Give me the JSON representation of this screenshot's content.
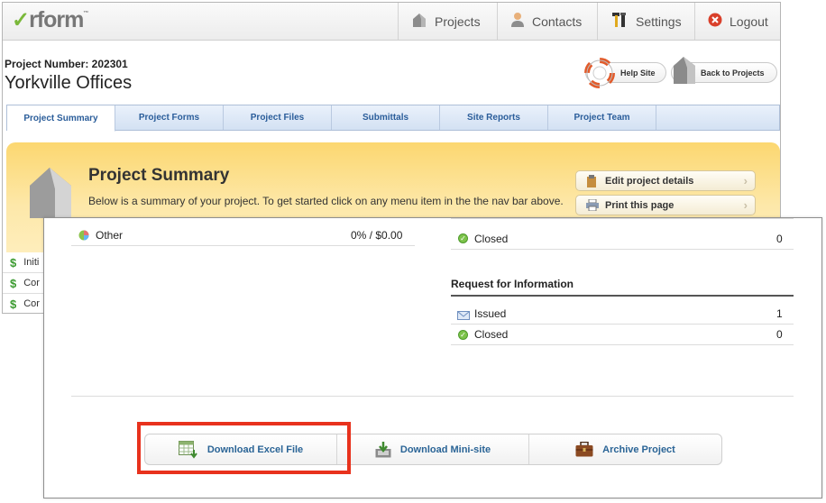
{
  "brand": {
    "logo_check": "✓",
    "logo_text": "rform",
    "logo_tm": "™"
  },
  "top_nav": {
    "projects": "Projects",
    "contacts": "Contacts",
    "settings": "Settings",
    "logout": "Logout"
  },
  "project": {
    "number_label": "Project Number: 202301",
    "name": "Yorkville Offices"
  },
  "header_links": {
    "help_site": "Help Site",
    "back_to_projects": "Back to Projects"
  },
  "tabs": [
    {
      "label": "Project Summary",
      "active": true
    },
    {
      "label": "Project Forms"
    },
    {
      "label": "Project Files"
    },
    {
      "label": "Submittals"
    },
    {
      "label": "Site Reports"
    },
    {
      "label": "Project Team"
    }
  ],
  "summary": {
    "title": "Project Summary",
    "description": "Below is a summary of your project. To get started click on any menu item in the the nav bar above.",
    "edit_details": "Edit project details",
    "print_page": "Print this page"
  },
  "cost_rows": [
    {
      "label": "Initi"
    },
    {
      "label": "Cor"
    },
    {
      "label": "Cor"
    }
  ],
  "cost_breakdown": {
    "other_label": "Other",
    "other_value": "0% / $0.00"
  },
  "status_top": {
    "closed_label": "Closed",
    "closed_count": "0"
  },
  "rfi": {
    "heading": "Request for Information",
    "issued_label": "Issued",
    "issued_count": "1",
    "closed_label": "Closed",
    "closed_count": "0"
  },
  "actions": {
    "download_excel": "Download Excel File",
    "download_minisite": "Download Mini-site",
    "archive_project": "Archive Project"
  },
  "colors": {
    "highlight": "#e8321d",
    "link_blue": "#2a6496",
    "tab_blue": "#2a5d9a",
    "summary_yellow": "#fcd770",
    "status_green": "#7cc34a"
  }
}
